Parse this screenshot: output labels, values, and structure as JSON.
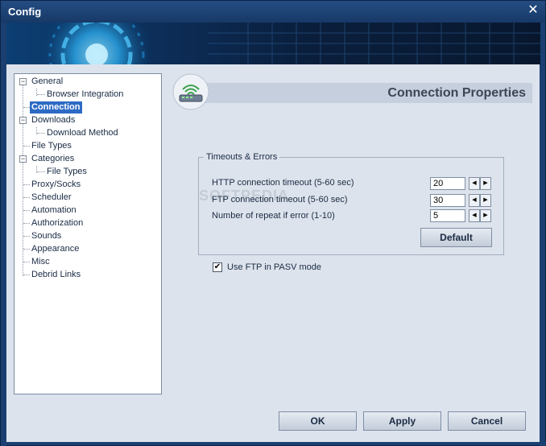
{
  "window": {
    "title": "Config",
    "close_glyph": "✕"
  },
  "banner": {
    "colors": [
      "#0c3e73",
      "#08172e"
    ]
  },
  "tree": {
    "items": [
      {
        "label": "General",
        "expander": "−"
      },
      {
        "label": "Browser Integration"
      },
      {
        "label": "Connection",
        "selected": true
      },
      {
        "label": "Downloads",
        "expander": "−"
      },
      {
        "label": "Download Method"
      },
      {
        "label": "File Types"
      },
      {
        "label": "Categories",
        "expander": "−"
      },
      {
        "label": "File Types"
      },
      {
        "label": "Proxy/Socks"
      },
      {
        "label": "Scheduler"
      },
      {
        "label": "Automation"
      },
      {
        "label": "Authorization"
      },
      {
        "label": "Sounds"
      },
      {
        "label": "Appearance"
      },
      {
        "label": "Misc"
      },
      {
        "label": "Debrid Links"
      }
    ]
  },
  "header": {
    "title": "Connection Properties",
    "icon": "router-icon"
  },
  "timeouts": {
    "group_title": "Timeouts & Errors",
    "rows": [
      {
        "label": "HTTP connection timeout (5-60 sec)",
        "value": "20"
      },
      {
        "label": "FTP connection timeout (5-60 sec)",
        "value": "30"
      },
      {
        "label": "Number of repeat if error (1-10)",
        "value": "5"
      }
    ],
    "spin_down": "◀",
    "spin_up": "▶",
    "default_label": "Default"
  },
  "pasv": {
    "label": "Use FTP in PASV mode",
    "checked_glyph": "✔"
  },
  "buttons": {
    "ok": "OK",
    "apply": "Apply",
    "cancel": "Cancel"
  },
  "watermark": "SOFTPEDIA"
}
